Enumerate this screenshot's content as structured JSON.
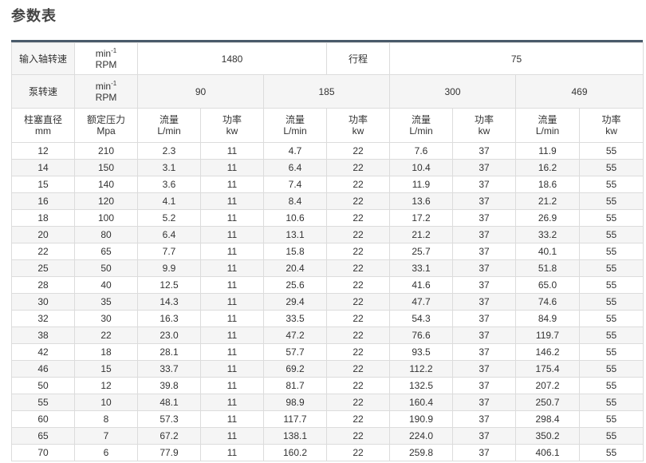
{
  "title": "参数表",
  "header": {
    "row1": {
      "label": "输入轴转速",
      "unit_main": "min",
      "unit_sup": "-1",
      "unit_sub": "RPM",
      "speed": "1480",
      "stroke_label": "行程",
      "stroke": "75"
    },
    "row2": {
      "label": "泵转速",
      "unit_main": "min",
      "unit_sup": "-1",
      "unit_sub": "RPM",
      "speeds": [
        "90",
        "185",
        "300",
        "469"
      ]
    },
    "row3": {
      "plunger": [
        "柱塞直径",
        "mm"
      ],
      "pressure": [
        "额定压力",
        "Mpa"
      ],
      "flow": [
        "流量",
        "L/min"
      ],
      "power": [
        "功率",
        "kw"
      ]
    }
  },
  "rows": [
    [
      "12",
      "210",
      "2.3",
      "11",
      "4.7",
      "22",
      "7.6",
      "37",
      "11.9",
      "55"
    ],
    [
      "14",
      "150",
      "3.1",
      "11",
      "6.4",
      "22",
      "10.4",
      "37",
      "16.2",
      "55"
    ],
    [
      "15",
      "140",
      "3.6",
      "11",
      "7.4",
      "22",
      "11.9",
      "37",
      "18.6",
      "55"
    ],
    [
      "16",
      "120",
      "4.1",
      "11",
      "8.4",
      "22",
      "13.6",
      "37",
      "21.2",
      "55"
    ],
    [
      "18",
      "100",
      "5.2",
      "11",
      "10.6",
      "22",
      "17.2",
      "37",
      "26.9",
      "55"
    ],
    [
      "20",
      "80",
      "6.4",
      "11",
      "13.1",
      "22",
      "21.2",
      "37",
      "33.2",
      "55"
    ],
    [
      "22",
      "65",
      "7.7",
      "11",
      "15.8",
      "22",
      "25.7",
      "37",
      "40.1",
      "55"
    ],
    [
      "25",
      "50",
      "9.9",
      "11",
      "20.4",
      "22",
      "33.1",
      "37",
      "51.8",
      "55"
    ],
    [
      "28",
      "40",
      "12.5",
      "11",
      "25.6",
      "22",
      "41.6",
      "37",
      "65.0",
      "55"
    ],
    [
      "30",
      "35",
      "14.3",
      "11",
      "29.4",
      "22",
      "47.7",
      "37",
      "74.6",
      "55"
    ],
    [
      "32",
      "30",
      "16.3",
      "11",
      "33.5",
      "22",
      "54.3",
      "37",
      "84.9",
      "55"
    ],
    [
      "38",
      "22",
      "23.0",
      "11",
      "47.2",
      "22",
      "76.6",
      "37",
      "119.7",
      "55"
    ],
    [
      "42",
      "18",
      "28.1",
      "11",
      "57.7",
      "22",
      "93.5",
      "37",
      "146.2",
      "55"
    ],
    [
      "46",
      "15",
      "33.7",
      "11",
      "69.2",
      "22",
      "112.2",
      "37",
      "175.4",
      "55"
    ],
    [
      "50",
      "12",
      "39.8",
      "11",
      "81.7",
      "22",
      "132.5",
      "37",
      "207.2",
      "55"
    ],
    [
      "55",
      "10",
      "48.1",
      "11",
      "98.9",
      "22",
      "160.4",
      "37",
      "250.7",
      "55"
    ],
    [
      "60",
      "8",
      "57.3",
      "11",
      "117.7",
      "22",
      "190.9",
      "37",
      "298.4",
      "55"
    ],
    [
      "65",
      "7",
      "67.2",
      "11",
      "138.1",
      "22",
      "224.0",
      "37",
      "350.2",
      "55"
    ],
    [
      "70",
      "6",
      "77.9",
      "11",
      "160.2",
      "22",
      "259.8",
      "37",
      "406.1",
      "55"
    ]
  ]
}
